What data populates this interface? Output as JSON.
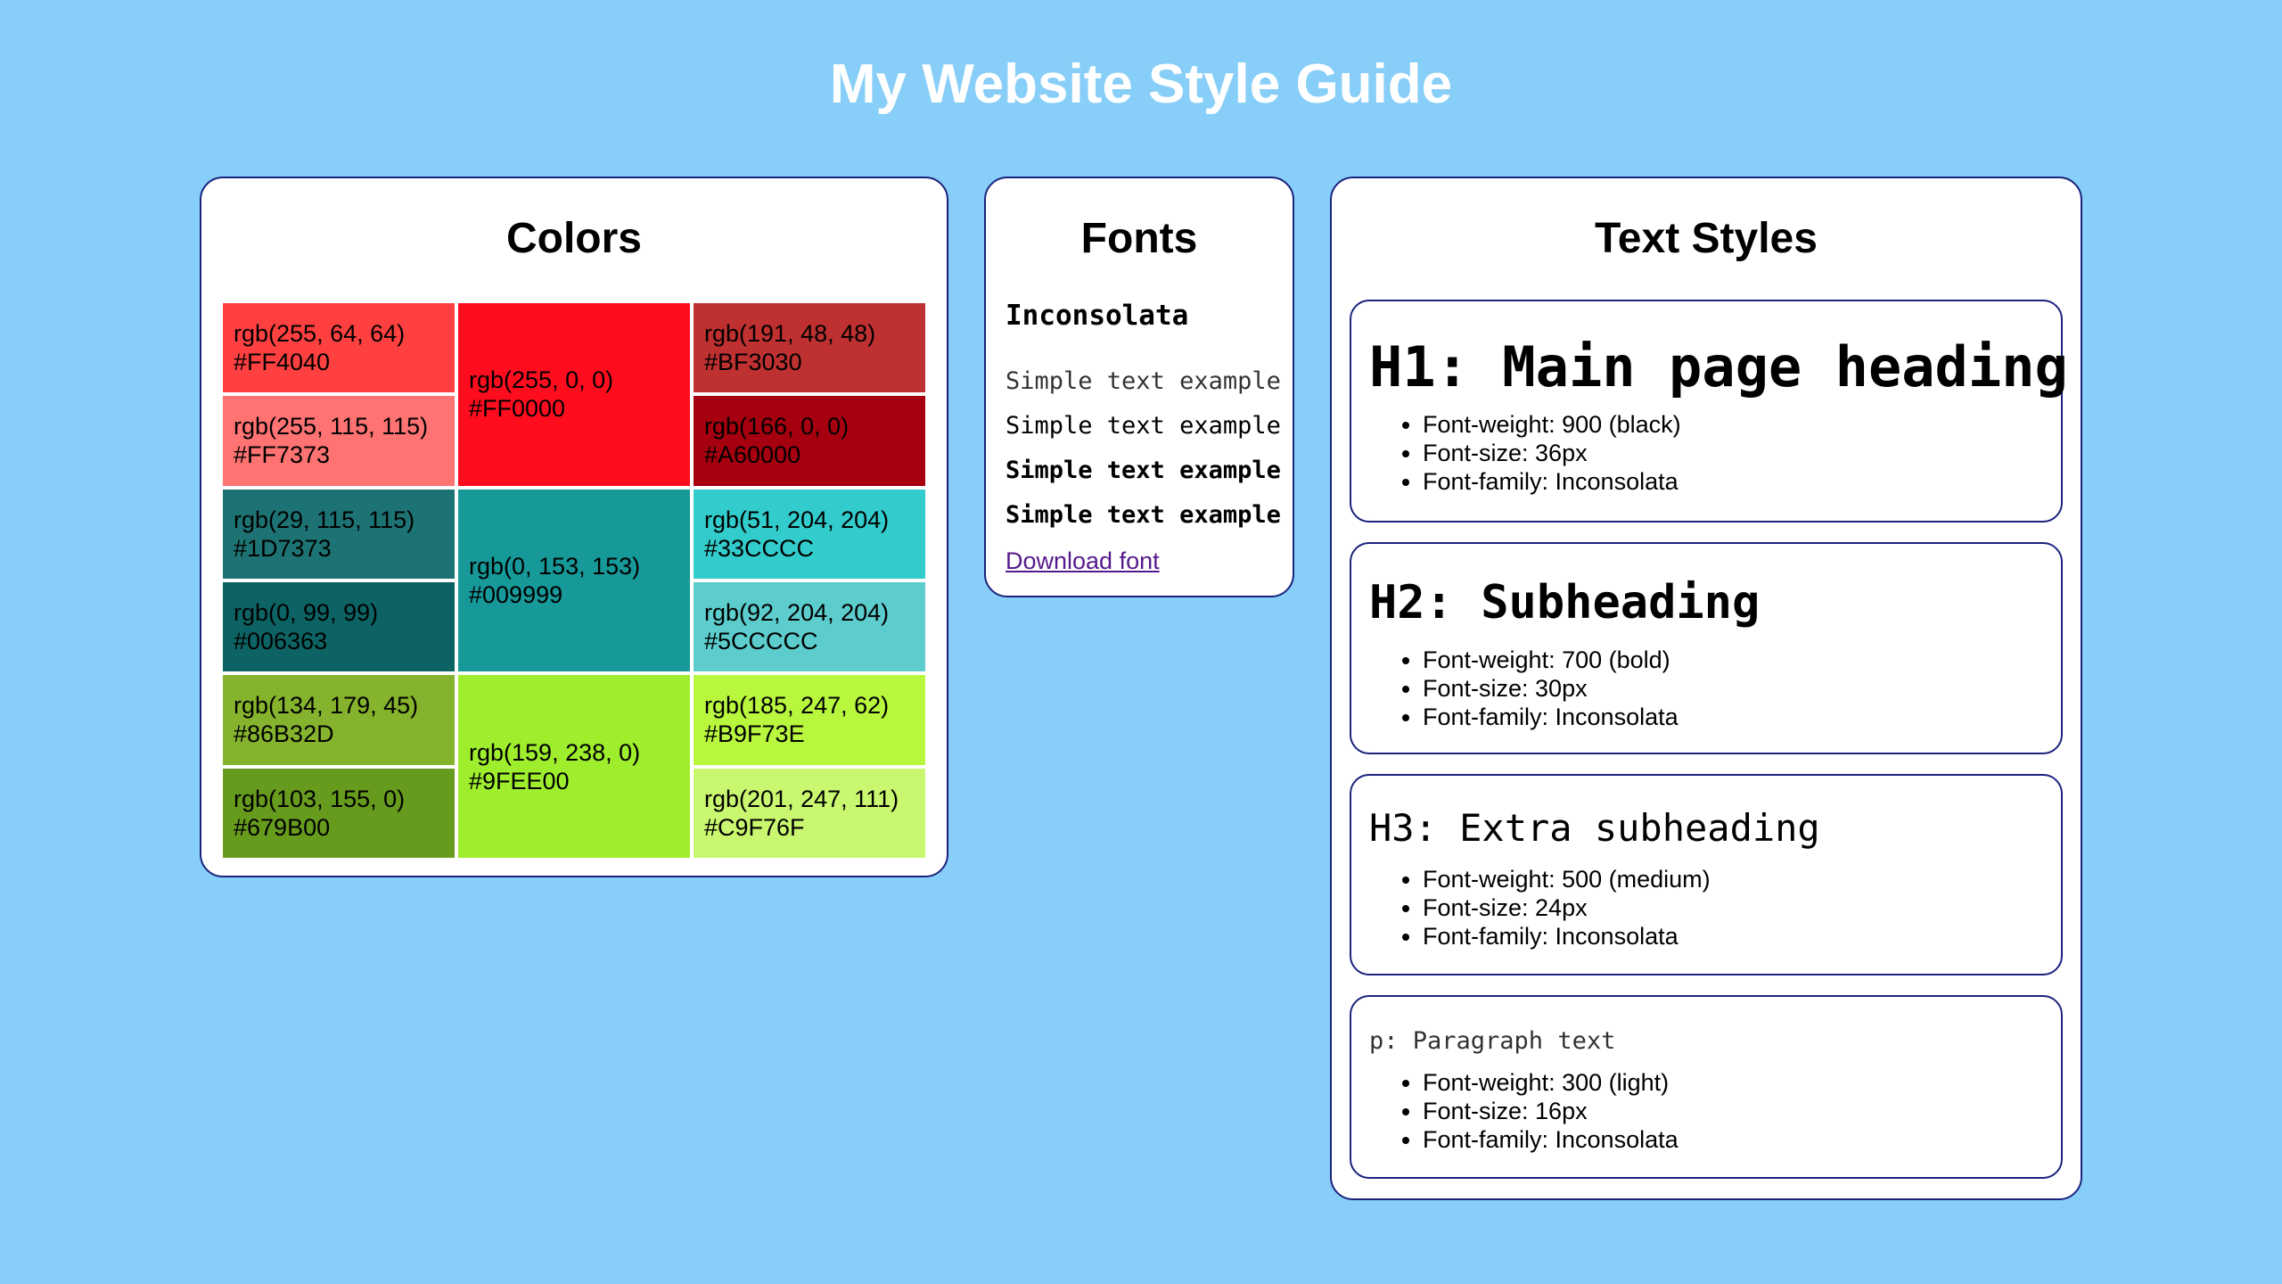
{
  "page": {
    "title": "My Website Style Guide",
    "background": "#87CEF8"
  },
  "colors_card": {
    "title": "Colors",
    "swatches": [
      {
        "rgb": "rgb(255, 64, 64)",
        "hex": "#FF4040",
        "color": "#FF4040",
        "tall": false
      },
      {
        "rgb": "rgb(255, 0, 0)",
        "hex": "#FF0000",
        "color": "#FF0D1F",
        "tall": true
      },
      {
        "rgb": "rgb(191, 48, 48)",
        "hex": "#BF3030",
        "color": "#BF3030",
        "tall": false
      },
      {
        "rgb": "rgb(255, 115, 115)",
        "hex": "#FF7373",
        "color": "#FF7373",
        "tall": false
      },
      {
        "rgb": "rgb(166, 0, 0)",
        "hex": "#A60000",
        "color": "#A60010",
        "tall": false
      },
      {
        "rgb": "rgb(29, 115, 115)",
        "hex": "#1D7373",
        "color": "#1D7373",
        "tall": false
      },
      {
        "rgb": "rgb(0, 153, 153)",
        "hex": "#009999",
        "color": "#179999",
        "tall": true
      },
      {
        "rgb": "rgb(51, 204, 204)",
        "hex": "#33CCCC",
        "color": "#33CCCC",
        "tall": false
      },
      {
        "rgb": "rgb(0, 99, 99)",
        "hex": "#006363",
        "color": "#0D6363",
        "tall": false
      },
      {
        "rgb": "rgb(92, 204, 204)",
        "hex": "#5CCCCC",
        "color": "#5CCCCC",
        "tall": false
      },
      {
        "rgb": "rgb(134, 179, 45)",
        "hex": "#86B32D",
        "color": "#86B32D",
        "tall": false
      },
      {
        "rgb": "rgb(159, 238, 0)",
        "hex": "#9FEE00",
        "color": "#9FEE2D",
        "tall": true
      },
      {
        "rgb": "rgb(185, 247, 62)",
        "hex": "#B9F73E",
        "color": "#B9F73E",
        "tall": false
      },
      {
        "rgb": "rgb(103, 155, 0)",
        "hex": "#679B00",
        "color": "#679B1D",
        "tall": false
      },
      {
        "rgb": "rgb(201, 247, 111)",
        "hex": "#C9F76F",
        "color": "#C9F76F",
        "tall": false
      }
    ]
  },
  "fonts_card": {
    "title": "Fonts",
    "font_name": "Inconsolata",
    "samples": [
      "Simple text example",
      "Simple text example",
      "Simple text example",
      "Simple text example"
    ],
    "download_label": "Download font"
  },
  "text_styles_card": {
    "title": "Text Styles",
    "styles": [
      {
        "heading": "H1: Main page heading",
        "props": [
          "Font-weight: 900 (black)",
          "Font-size: 36px",
          "Font-family: Inconsolata"
        ]
      },
      {
        "heading": "H2: Subheading",
        "props": [
          "Font-weight: 700 (bold)",
          "Font-size: 30px",
          "Font-family: Inconsolata"
        ]
      },
      {
        "heading": "H3: Extra subheading",
        "props": [
          "Font-weight: 500 (medium)",
          "Font-size: 24px",
          "Font-family: Inconsolata"
        ]
      },
      {
        "heading": "p: Paragraph text",
        "props": [
          "Font-weight: 300 (light)",
          "Font-size: 16px",
          "Font-family: Inconsolata"
        ]
      }
    ]
  }
}
